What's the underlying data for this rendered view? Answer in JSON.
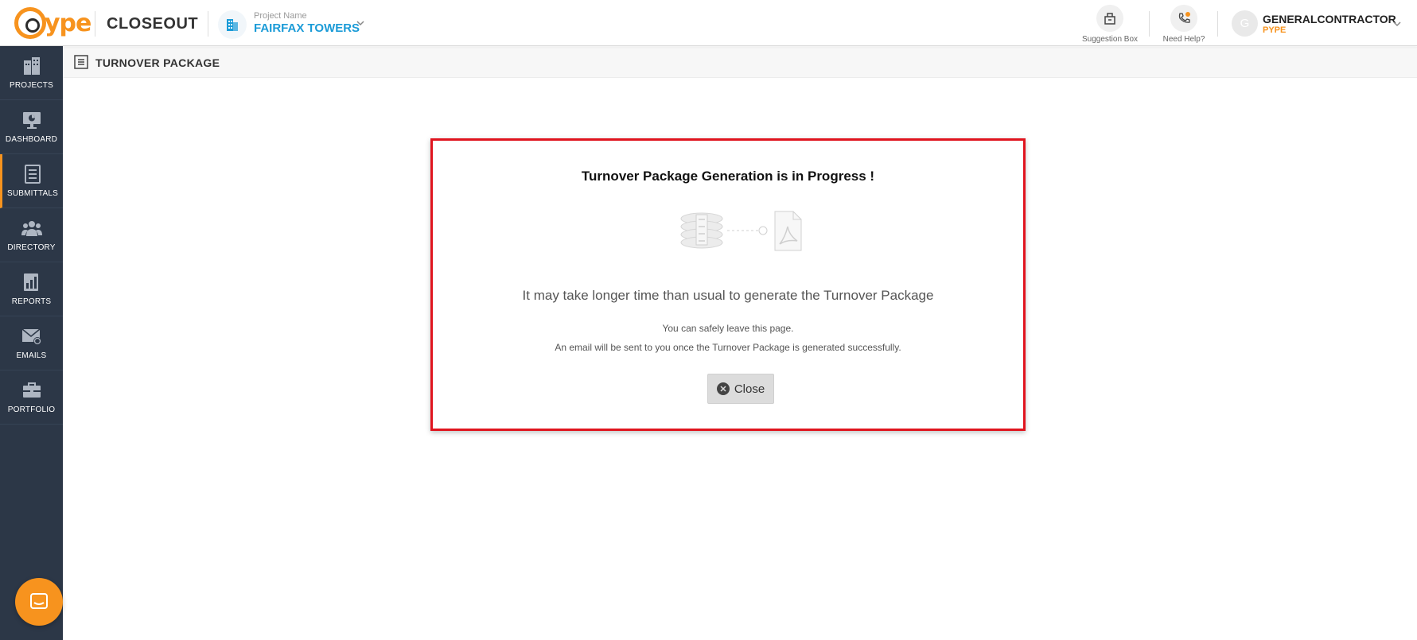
{
  "brand": {
    "logo_text": "ype",
    "app_name": "CLOSEOUT",
    "accent": "#f7931e"
  },
  "project": {
    "label": "Project Name",
    "name": "FAIRFAX TOWERS",
    "icon": "building-icon"
  },
  "header_utils": [
    {
      "label": "Suggestion Box",
      "icon": "suggestion-box-icon"
    },
    {
      "label": "Need Help?",
      "icon": "phone-help-icon"
    }
  ],
  "user": {
    "avatar_initial": "G",
    "name": "GENERALCONTRACTOR",
    "org": "PYPE"
  },
  "sidebar": {
    "items": [
      {
        "label": "PROJECTS",
        "icon": "buildings-icon"
      },
      {
        "label": "DASHBOARD",
        "icon": "monitor-chart-icon"
      },
      {
        "label": "SUBMITTALS",
        "icon": "document-list-icon",
        "active": true
      },
      {
        "label": "DIRECTORY",
        "icon": "people-icon"
      },
      {
        "label": "REPORTS",
        "icon": "report-chart-icon"
      },
      {
        "label": "EMAILS",
        "icon": "envelope-icon"
      },
      {
        "label": "PORTFOLIO",
        "icon": "briefcase-icon"
      }
    ]
  },
  "subheader": {
    "title": "TURNOVER PACKAGE"
  },
  "modal": {
    "title": "Turnover Package Generation is in Progress !",
    "main_text": "It may take longer time than usual to generate the Turnover Package",
    "line1": "You can safely leave this page.",
    "line2": "An email will be sent to you once the Turnover Package is generated successfully.",
    "close_label": "Close"
  },
  "colors": {
    "highlight_border": "#e0141e",
    "sidebar_bg": "#2c3747",
    "project_blue": "#1b9bd7"
  }
}
